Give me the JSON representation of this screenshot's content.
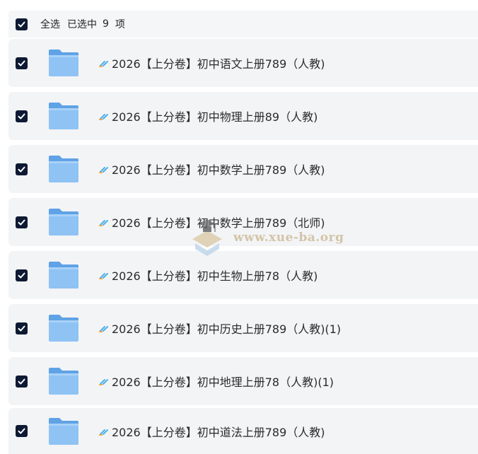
{
  "header": {
    "select_all_label": "全选",
    "selected_prefix": "已选中",
    "selected_count": "9",
    "selected_unit": "项"
  },
  "items": [
    {
      "name": "2026【上分卷】初中语文上册789（人教)",
      "checked": true,
      "icon": "folder-icon"
    },
    {
      "name": "2026【上分卷】初中物理上册89（人教)",
      "checked": true,
      "icon": "folder-icon"
    },
    {
      "name": "2026【上分卷】初中数学上册789（人教)",
      "checked": true,
      "icon": "folder-icon"
    },
    {
      "name": "2026【上分卷】初中数学上册789（北师)",
      "checked": true,
      "icon": "folder-icon"
    },
    {
      "name": "2026【上分卷】初中生物上册78（人教)",
      "checked": true,
      "icon": "folder-icon"
    },
    {
      "name": "2026【上分卷】初中历史上册789（人教)(1)",
      "checked": true,
      "icon": "folder-icon"
    },
    {
      "name": "2026【上分卷】初中地理上册78（人教)(1)",
      "checked": true,
      "icon": "folder-icon"
    },
    {
      "name": "2026【上分卷】初中道法上册789（人教)",
      "checked": true,
      "icon": "folder-icon"
    }
  ],
  "watermark": {
    "text": "www.xue-ba.org"
  },
  "colors": {
    "checkbox": "#0e1a33",
    "row_background": "#f3f4f6",
    "folder": "#7db6ee"
  }
}
